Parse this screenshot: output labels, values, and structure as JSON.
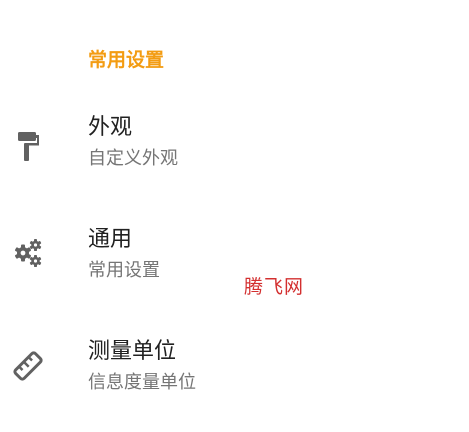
{
  "colors": {
    "accent": "#f39c12",
    "title": "#212121",
    "summary": "#757575",
    "icon": "#616161",
    "watermark": "#d32f2f"
  },
  "section": {
    "header": "常用设置"
  },
  "items": [
    {
      "icon": "paint-roller-icon",
      "title": "外观",
      "summary": "自定义外观"
    },
    {
      "icon": "gears-icon",
      "title": "通用",
      "summary": "常用设置"
    },
    {
      "icon": "ruler-icon",
      "title": "测量单位",
      "summary": "信息度量单位"
    }
  ],
  "watermark": "腾飞网"
}
